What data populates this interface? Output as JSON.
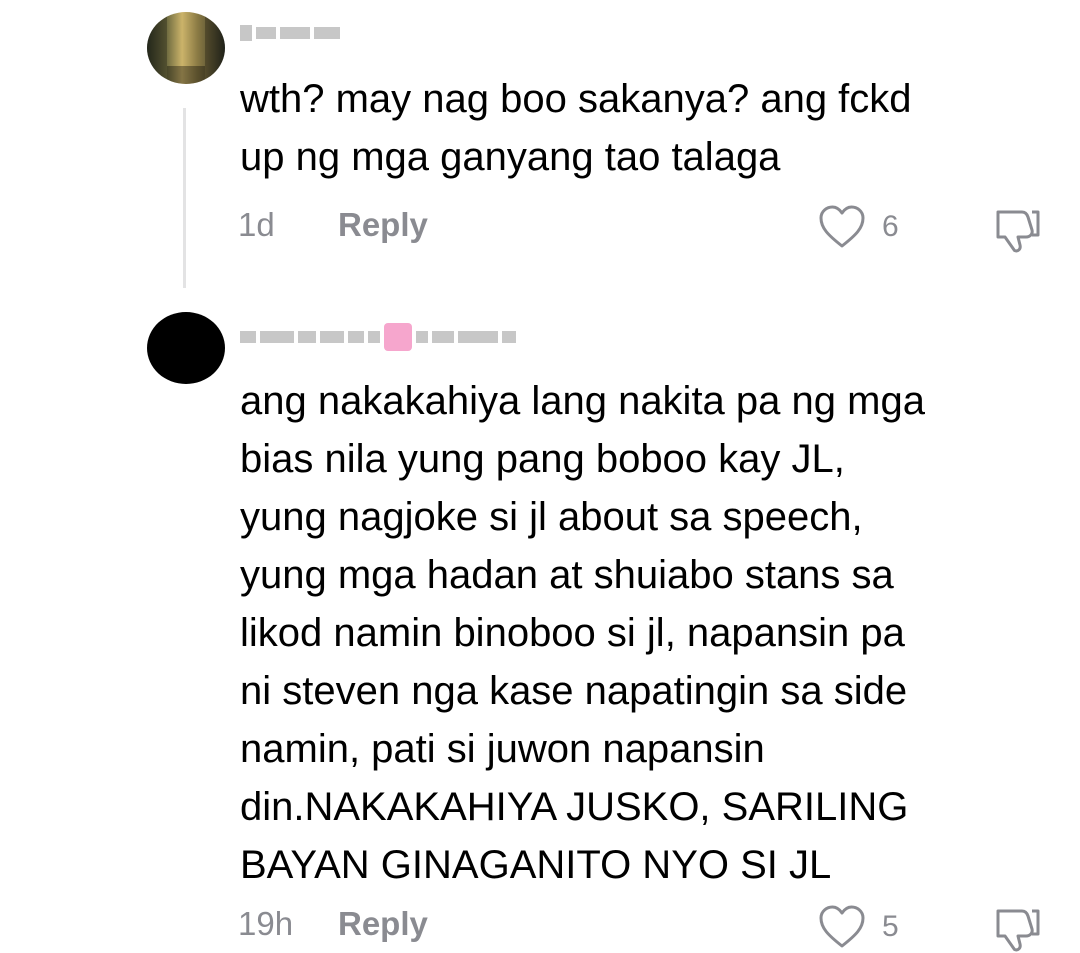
{
  "comments": [
    {
      "username": "",
      "text": "wth? may nag boo sakanya? ang fckd\nup ng mga ganyang tao talaga",
      "time": "1d",
      "reply_label": "Reply",
      "likes": "6"
    },
    {
      "username": "",
      "text": "ang nakakahiya lang nakita pa ng mga\nbias nila yung pang boboo kay JL,\nyung nagjoke si jl about sa speech,\nyung mga hadan at shuiabo stans sa\nlikod namin binoboo si jl, napansin pa\nni steven nga kase napatingin sa side\nnamin, pati si juwon napansin\ndin.NAKAKAHIYA JUSKO, SARILING\nBAYAN GINAGANITO NYO SI JL",
      "time": "19h",
      "reply_label": "Reply",
      "likes": "5"
    }
  ],
  "icons": {
    "like": "heart-outline-icon",
    "dislike": "thumbs-down-outline-icon"
  },
  "colors": {
    "text": "#000000",
    "meta": "#8a8b91",
    "thread_line": "#e3e3e4"
  }
}
